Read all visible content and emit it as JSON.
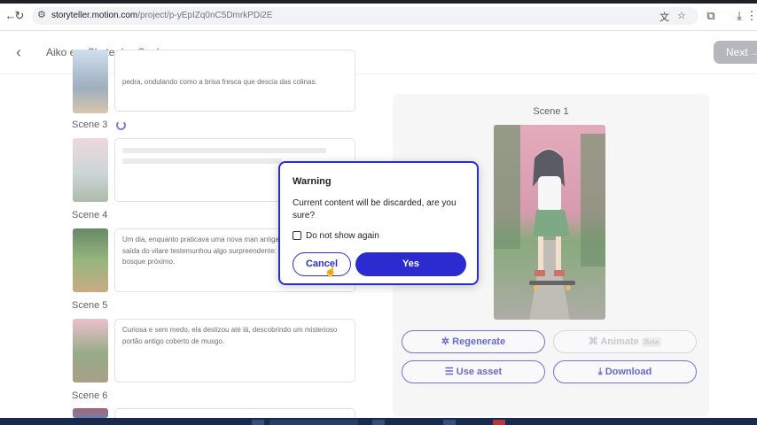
{
  "browser": {
    "url_host": "storyteller.motion.com",
    "url_path": "/project/p-yEpIZq0nC5DmrkPDi2E"
  },
  "header": {
    "back_icon": "arrow-left-icon",
    "title": "Aiko e o Skate dos Sonhos",
    "next_label": "Next"
  },
  "scenes": [
    {
      "label": "",
      "text": "pedra, ondulando como a brisa fresca que descia das colinas."
    },
    {
      "label": "Scene 3",
      "text": ""
    },
    {
      "label": "Scene 4",
      "text": "Um dia, enquanto praticava uma nova man antiga ponte de madeira na saída do vilare testemunhou algo surpreendente: uma luz emanava do bosque próximo."
    },
    {
      "label": "Scene 5",
      "text": "Curiosa e sem medo, ela deslizou até lá, descobrindo um misterioso portão antigo coberto de musgo."
    },
    {
      "label": "Scene 6",
      "text": ""
    }
  ],
  "preview": {
    "title": "Scene 1",
    "buttons": {
      "regenerate": "Regenerate",
      "animate": "Animate",
      "animate_badge": "Beta",
      "use_asset": "Use asset",
      "download": "Download"
    }
  },
  "modal": {
    "title": "Warning",
    "message": "Current content will be discarded, are you sure?",
    "checkbox_label": "Do not show again",
    "checkbox_checked": false,
    "cancel_label": "Cancel",
    "yes_label": "Yes"
  },
  "colors": {
    "accent": "#2b2bd0",
    "next_disabled": "#9a9aa4"
  }
}
